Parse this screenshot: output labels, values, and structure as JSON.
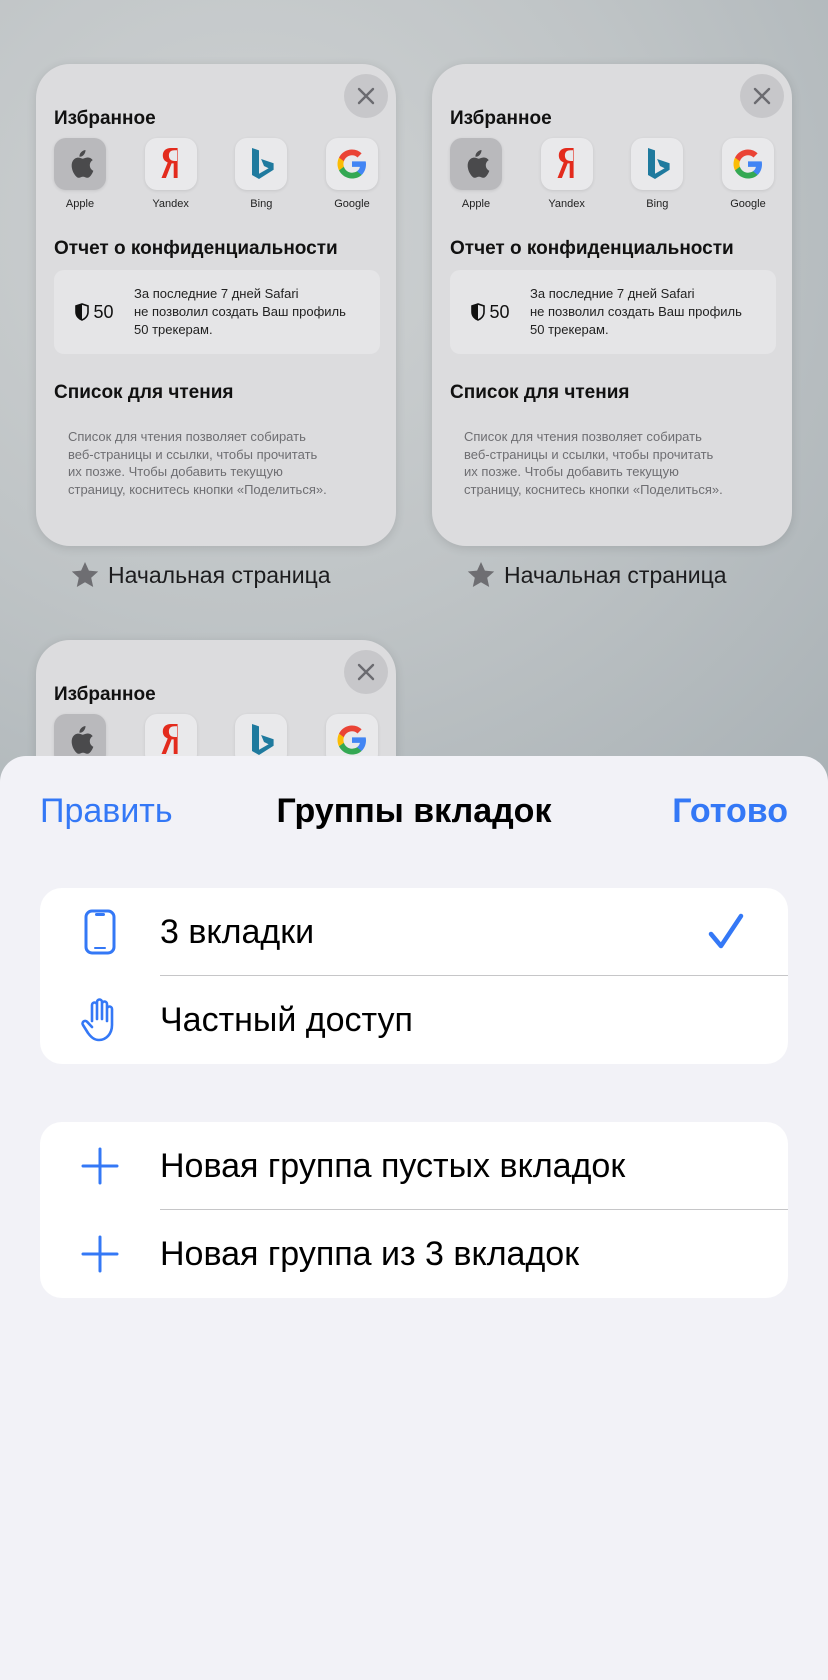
{
  "tab_cards": [
    {
      "favorites_title": "Избранное",
      "favorites": [
        {
          "label": "Apple",
          "icon": "apple-icon"
        },
        {
          "label": "Yandex",
          "icon": "yandex-icon"
        },
        {
          "label": "Bing",
          "icon": "bing-icon"
        },
        {
          "label": "Google",
          "icon": "google-icon"
        }
      ],
      "privacy_title": "Отчет о конфиденциальности",
      "privacy_count": "50",
      "privacy_text": "За последние 7 дней Safari\nне позволил создать Ваш профиль\n50 трекерам.",
      "reading_title": "Список для чтения",
      "reading_text": "Список для чтения позволяет собирать\nвеб-страницы и ссылки, чтобы прочитать\nих позже. Чтобы добавить текущую\nстраницу, коснитесь кнопки «Поделиться».",
      "label": "Начальная страница"
    },
    {
      "favorites_title": "Избранное",
      "favorites": [
        {
          "label": "Apple",
          "icon": "apple-icon"
        },
        {
          "label": "Yandex",
          "icon": "yandex-icon"
        },
        {
          "label": "Bing",
          "icon": "bing-icon"
        },
        {
          "label": "Google",
          "icon": "google-icon"
        }
      ],
      "privacy_title": "Отчет о конфиденциальности",
      "privacy_count": "50",
      "privacy_text": "За последние 7 дней Safari\nне позволил создать Ваш профиль\n50 трекерам.",
      "reading_title": "Список для чтения",
      "reading_text": "Список для чтения позволяет собирать\nвеб-страницы и ссылки, чтобы прочитать\nих позже. Чтобы добавить текущую\nстраницу, коснитесь кнопки «Поделиться».",
      "label": "Начальная страница"
    },
    {
      "favorites_title": "Избранное"
    }
  ],
  "sheet": {
    "edit_label": "Править",
    "title": "Группы вкладок",
    "done_label": "Готово",
    "groups": [
      {
        "label": "3 вкладки",
        "icon": "phone-icon",
        "selected": true
      },
      {
        "label": "Частный доступ",
        "icon": "hand-icon",
        "selected": false
      }
    ],
    "actions": [
      {
        "label": "Новая группа пустых вкладок",
        "icon": "plus-icon"
      },
      {
        "label": "Новая группа из 3 вкладок",
        "icon": "plus-icon"
      }
    ]
  },
  "colors": {
    "accent": "#3478f6",
    "sheet_bg": "#f2f2f7",
    "yandex_red": "#e32b1d",
    "bing_teal": "#1f7a9e"
  }
}
